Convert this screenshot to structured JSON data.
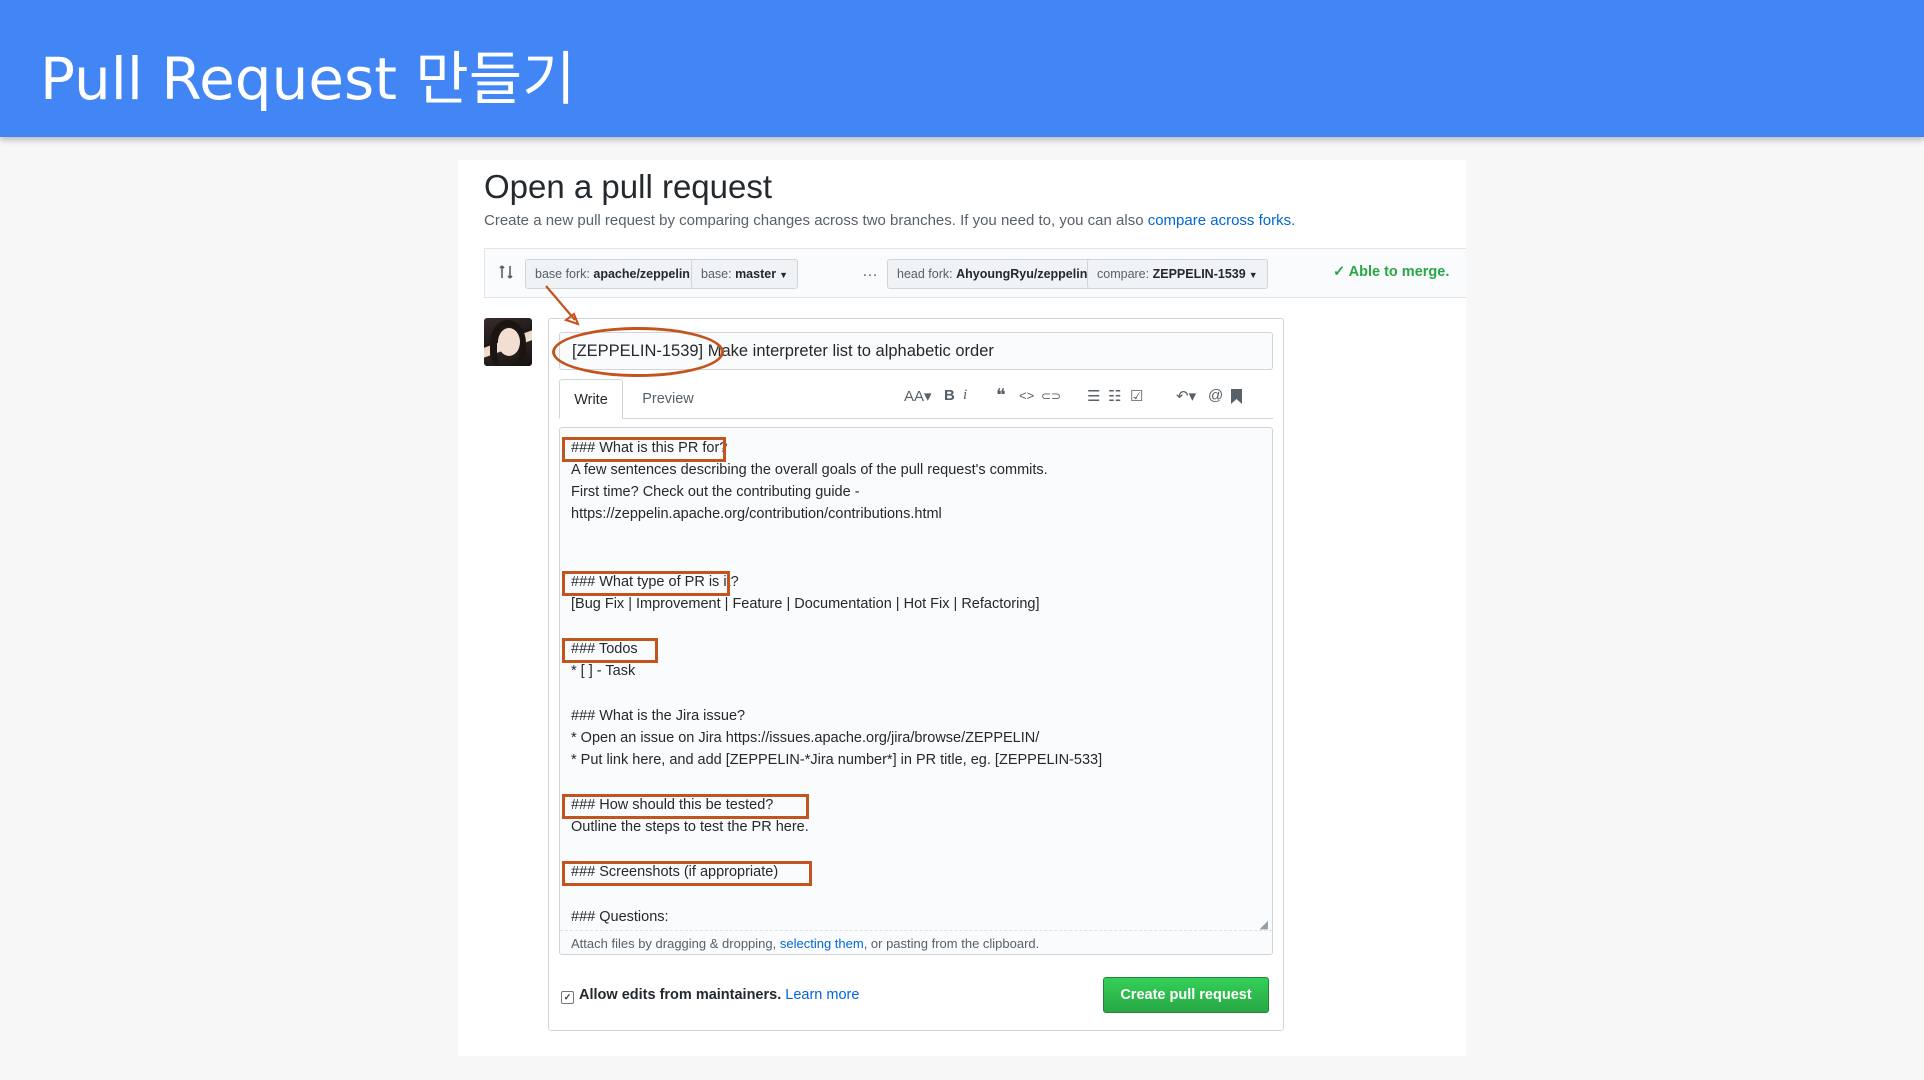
{
  "slide": {
    "title": "Pull Request 만들기"
  },
  "pr": {
    "title": "Open a pull request",
    "description": "Create a new pull request by comparing changes across two branches. If you need to, you can also ",
    "compare_forks_link": "compare across forks.",
    "base_fork_label": "base fork: ",
    "base_fork_value": "apache/zeppelin",
    "base_label": "base: ",
    "base_value": "master",
    "ellipsis": "…",
    "head_fork_label": "head fork: ",
    "head_fork_value": "AhyoungRyu/zeppelin",
    "compare_label": "compare: ",
    "compare_value": "ZEPPELIN-1539",
    "merge_status": "✓ Able to merge.",
    "title_input_value": "[ZEPPELIN-1539] Make interpreter list to alphabetic order",
    "tabs": {
      "write": "Write",
      "preview": "Preview"
    },
    "toolbar_icons": [
      "text-size-icon",
      "bold-icon",
      "italic-icon",
      "quote-icon",
      "code-icon",
      "link-icon",
      "bullet-list-icon",
      "numbered-list-icon",
      "task-list-icon",
      "reply-icon",
      "mention-icon",
      "bookmark-icon"
    ],
    "toolbar": {
      "text_size": "AA▾",
      "bold": "B",
      "italic": "i",
      "quote": "❝",
      "code": "<>",
      "link": "⊂⊃",
      "bullet": "☰",
      "numbered": "☷",
      "tasks": "☑",
      "reply": "↶▾",
      "mention": "@"
    },
    "body_lines": [
      "### What is this PR for?",
      "A few sentences describing the overall goals of the pull request's commits.",
      "First time? Check out the contributing guide -",
      "https://zeppelin.apache.org/contribution/contributions.html",
      "### What type of PR is it?",
      "[Bug Fix | Improvement | Feature | Documentation | Hot Fix | Refactoring]",
      "### Todos",
      "* [ ] - Task",
      "### What is the Jira issue?",
      "* Open an issue on Jira https://issues.apache.org/jira/browse/ZEPPELIN/",
      "* Put link here, and add [ZEPPELIN-*Jira number*] in PR title, eg. [ZEPPELIN-533]",
      "### How should this be tested?",
      "Outline the steps to test the PR here.",
      "### Screenshots (if appropriate)",
      "### Questions:"
    ],
    "attach_prefix": "Attach files by dragging & dropping, ",
    "attach_link": "selecting them",
    "attach_suffix": ", or pasting from the clipboard.",
    "allow_edits_label": "Allow edits from maintainers.",
    "learn_more": "Learn more",
    "create_button": "Create pull request"
  },
  "colors": {
    "banner": "#4285f4",
    "highlight": "#c4541e",
    "create_button": "#28a745",
    "link": "#0366d6"
  }
}
